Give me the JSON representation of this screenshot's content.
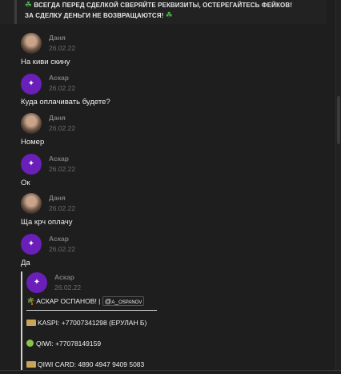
{
  "notice": {
    "icon": "clover-icon",
    "line1": "ВСЕГДА ПЕРЕД СДЕЛКОЙ СВЕРЯЙТЕ РЕКВИЗИТЫ, ОСТЕРЕГАЙТЕСЬ ФЕЙКОВ!",
    "line2": "ЗА СДЕЛКУ ДЕНЬГИ НЕ ВОЗВРАЩАЮТСЯ!"
  },
  "messages": [
    {
      "author": "Даня",
      "date": "26.02.22",
      "text": "На киви скину"
    },
    {
      "author": "Аскар",
      "date": "26.02.22",
      "text": "Куда оплачивать будете?"
    },
    {
      "author": "Даня",
      "date": "26.02.22",
      "text": "Номер"
    },
    {
      "author": "Аскар",
      "date": "26.02.22",
      "text": "Ок"
    },
    {
      "author": "Даня",
      "date": "26.02.22",
      "text": "Ща крч оплачу"
    },
    {
      "author": "Аскар",
      "date": "26.02.22",
      "text": "Да"
    }
  ],
  "quote": {
    "author": "Аскар",
    "date": "26.02.22",
    "name_line": "АСКАР ОСПАНОВ! |",
    "handle": "@a_ospanov",
    "kaspi": "KASPI: +77007341298 (ЕРУЛАН Б)",
    "qiwi": "QIWI: +77078149159",
    "qiwi_card": "QIWI CARD: 4890 4947 9409 5083"
  },
  "colors": {
    "background": "#1e1e1e",
    "askar_avatar": "#6a1fb8"
  }
}
